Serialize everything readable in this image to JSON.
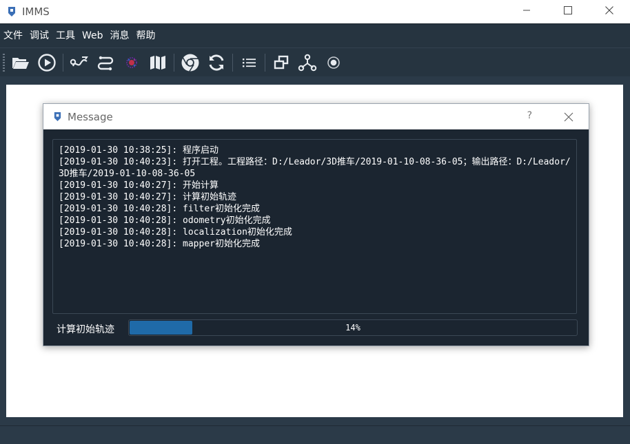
{
  "window": {
    "title": "IMMS"
  },
  "menu": {
    "items": [
      "文件",
      "调试",
      "工具",
      "Web",
      "消息",
      "帮助"
    ]
  },
  "toolbar": {
    "buttons": [
      {
        "icon": "folder-open-icon"
      },
      {
        "icon": "play-icon"
      },
      {
        "icon": "path-icon"
      },
      {
        "icon": "route-icon"
      },
      {
        "icon": "point-cloud-icon"
      },
      {
        "icon": "map-icon"
      },
      {
        "icon": "chrome-icon"
      },
      {
        "icon": "refresh-icon"
      },
      {
        "icon": "list-icon"
      },
      {
        "icon": "window-restore-icon"
      },
      {
        "icon": "network-icon"
      },
      {
        "icon": "record-icon"
      }
    ]
  },
  "dialog": {
    "title": "Message",
    "help_label": "?",
    "log_lines": [
      "[2019-01-30 10:38:25]: 程序启动",
      "[2019-01-30 10:40:23]: 打开工程。工程路径：D:/Leador/3D推车/2019-01-10-08-36-05；输出路径：D:/Leador/3D推车/2019-01-10-08-36-05",
      "[2019-01-30 10:40:27]: 开始计算",
      "[2019-01-30 10:40:27]: 计算初始轨迹",
      "[2019-01-30 10:40:28]: filter初始化完成",
      "[2019-01-30 10:40:28]: odometry初始化完成",
      "[2019-01-30 10:40:28]: localization初始化完成",
      "[2019-01-30 10:40:28]: mapper初始化完成"
    ],
    "status_label": "计算初始轨迹",
    "progress": {
      "percent": 14,
      "text": "14%"
    }
  },
  "colors": {
    "accent": "#1f6aa8",
    "panel": "#1c2631",
    "toolbar": "#263440"
  }
}
